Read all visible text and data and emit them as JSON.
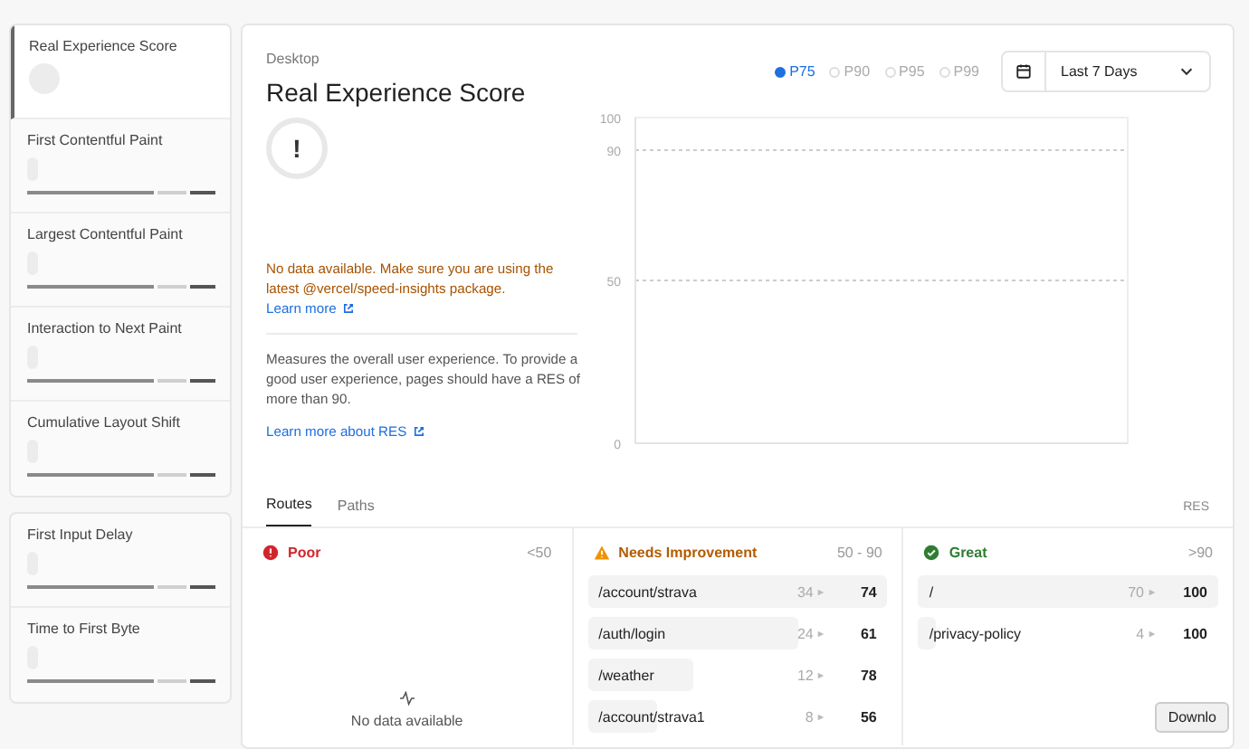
{
  "sidebar": {
    "groups": [
      {
        "items": [
          {
            "label": "Real Experience Score",
            "kind": "score",
            "selected": true
          },
          {
            "label": "First Contentful Paint",
            "kind": "metric",
            "selected": false
          },
          {
            "label": "Largest Contentful Paint",
            "kind": "metric",
            "selected": false
          },
          {
            "label": "Interaction to Next Paint",
            "kind": "metric",
            "selected": false
          },
          {
            "label": "Cumulative Layout Shift",
            "kind": "metric",
            "selected": false
          }
        ]
      },
      {
        "items": [
          {
            "label": "First Input Delay",
            "kind": "metric",
            "selected": false
          },
          {
            "label": "Time to First Byte",
            "kind": "metric",
            "selected": false
          }
        ]
      }
    ]
  },
  "main": {
    "device": "Desktop",
    "title": "Real Experience Score",
    "score_symbol": "!",
    "warning": "No data available. Make sure you are using the latest @vercel/speed-insights package.",
    "warning_link": "Learn more",
    "description": "Measures the overall user experience. To provide a good user experience, pages should have a RES of more than 90.",
    "description_link": "Learn more about RES",
    "percentiles": [
      {
        "label": "P75",
        "selected": true
      },
      {
        "label": "P90",
        "selected": false
      },
      {
        "label": "P95",
        "selected": false
      },
      {
        "label": "P99",
        "selected": false
      }
    ],
    "date_range": "Last 7 Days",
    "chart_data": {
      "type": "line",
      "categories": [
        null,
        null,
        null,
        null,
        null,
        null,
        null
      ],
      "ylim": [
        0,
        100
      ],
      "yticks": [
        0,
        50,
        90,
        100
      ],
      "series": [
        {
          "values": [
            null,
            null,
            null,
            null,
            null,
            null,
            null
          ]
        }
      ]
    }
  },
  "tabs": [
    {
      "label": "Routes",
      "selected": true
    },
    {
      "label": "Paths",
      "selected": false
    }
  ],
  "score_header": "RES",
  "columns": [
    {
      "kind": "poor",
      "label": "Poor",
      "range": "<50",
      "empty_text": "No data available"
    },
    {
      "kind": "needs",
      "label": "Needs Improvement",
      "range": "50 - 90",
      "rows": [
        {
          "route": "/account/strava",
          "count": "34",
          "score": "74",
          "level": 1.0
        },
        {
          "route": "/auth/login",
          "count": "24",
          "score": "61",
          "level": 0.7
        },
        {
          "route": "/weather",
          "count": "12",
          "score": "78",
          "level": 0.35
        },
        {
          "route": "/account/strava1",
          "count": "8",
          "score": "56",
          "level": 0.23
        }
      ]
    },
    {
      "kind": "great",
      "label": "Great",
      "range": ">90",
      "rows": [
        {
          "route": "/",
          "count": "70",
          "score": "100",
          "level": 1.0
        },
        {
          "route": "/privacy-policy",
          "count": "4",
          "score": "100",
          "level": 0.06
        }
      ]
    }
  ],
  "tooltip": "Downlo"
}
